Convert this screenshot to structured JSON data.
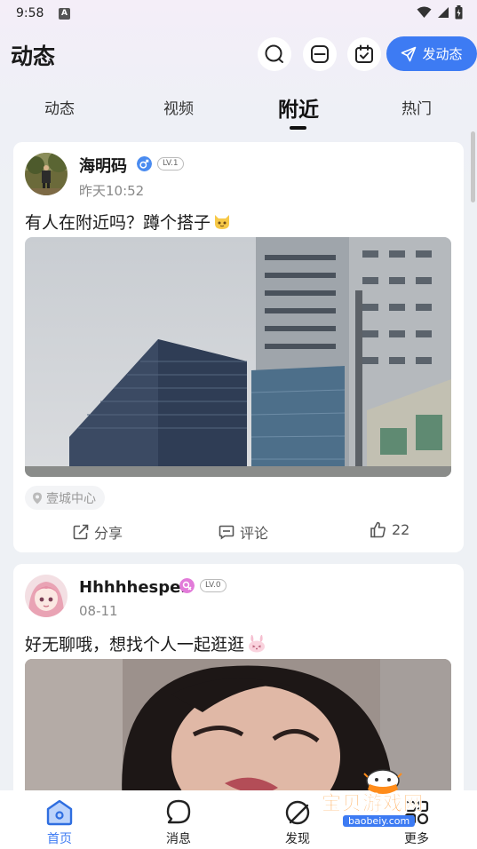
{
  "status_bar": {
    "time": "9:58",
    "notification_glyph": "A"
  },
  "header": {
    "title": "动态",
    "post_button_label": "发动态"
  },
  "tabs": [
    {
      "label": "动态",
      "active": false
    },
    {
      "label": "视频",
      "active": false
    },
    {
      "label": "附近",
      "active": true
    },
    {
      "label": "热门",
      "active": false
    }
  ],
  "posts": [
    {
      "username": "海明码",
      "gender_icon": "male-icon",
      "level": "LV.1",
      "time": "昨天10:52",
      "text": "有人在附近吗？蹲个搭子",
      "location": "壹城中心",
      "actions": {
        "share": "分享",
        "comment": "评论",
        "likes": "22"
      }
    },
    {
      "username": "Hhhhhesper",
      "gender_icon": "female-icon",
      "level": "LV.0",
      "time": "08-11",
      "text": "好无聊哦，想找个人一起逛逛"
    }
  ],
  "bottom_nav": [
    {
      "label": "首页",
      "icon": "home-icon",
      "active": true
    },
    {
      "label": "消息",
      "icon": "message-icon",
      "active": false
    },
    {
      "label": "发现",
      "icon": "discover-icon",
      "active": false
    },
    {
      "label": "更多",
      "icon": "more-icon",
      "active": false
    }
  ],
  "watermark": {
    "text": "宝贝游戏网",
    "url": "baobeiy.com"
  },
  "colors": {
    "accent": "#3d7bf3",
    "background": "#eef1f5"
  }
}
